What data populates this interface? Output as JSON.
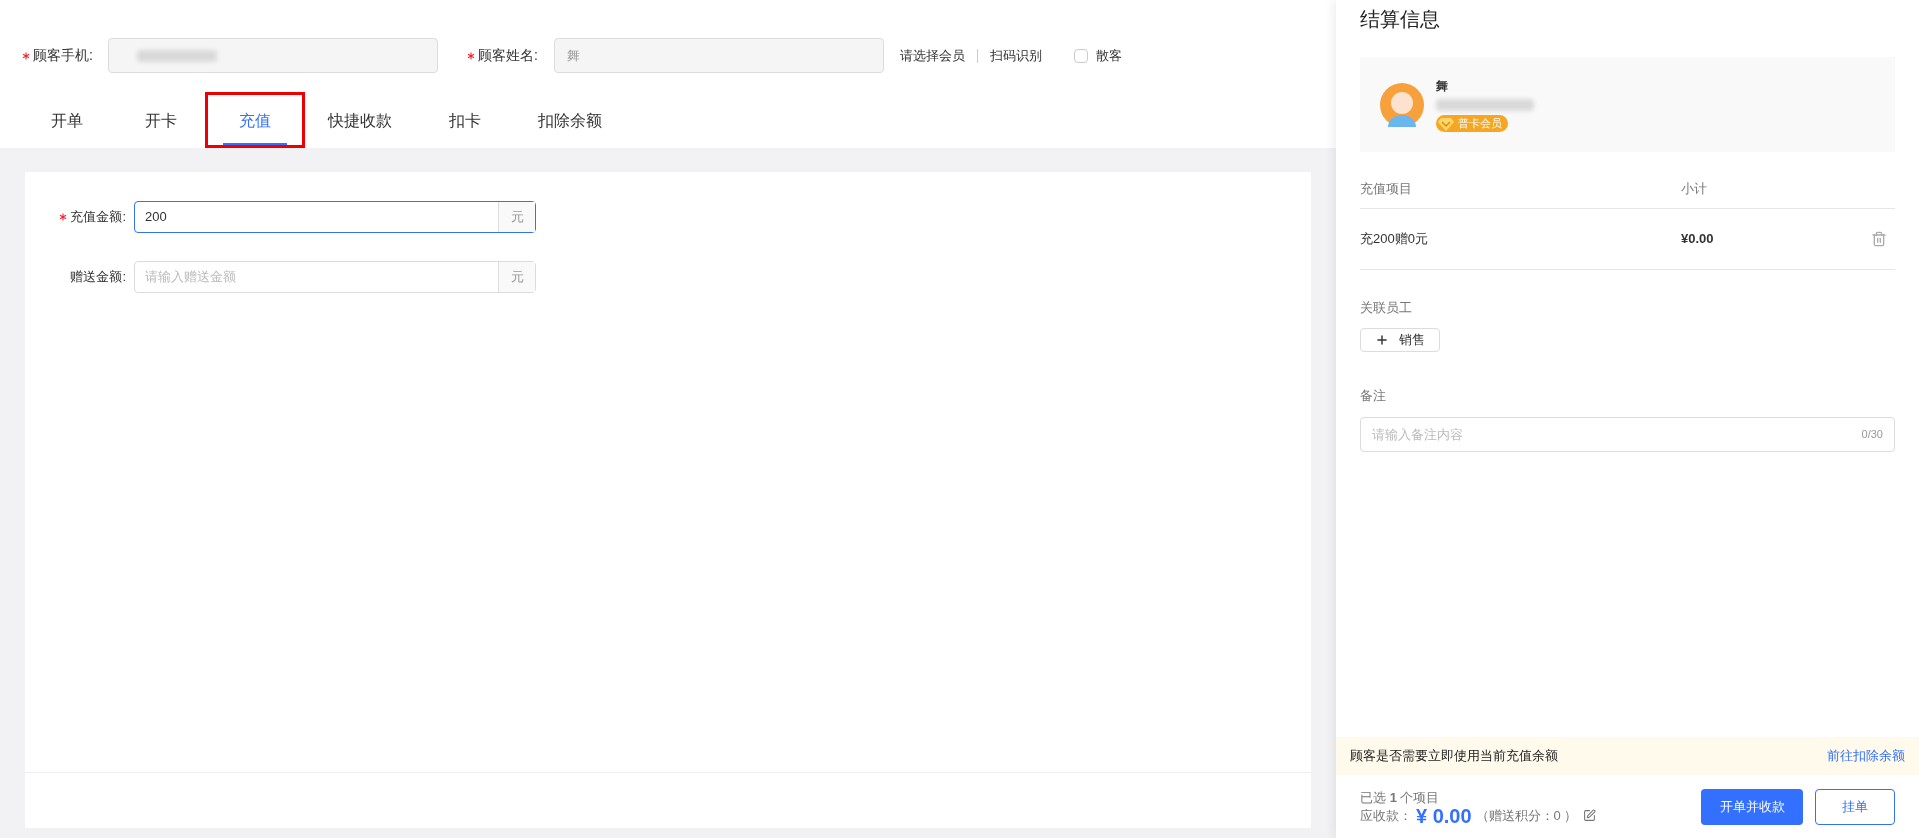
{
  "customer": {
    "phone": {
      "label": "顾客手机:",
      "required": true
    },
    "name": {
      "label": "顾客姓名:",
      "required": true,
      "value": "舞"
    },
    "links": [
      "请选择会员",
      "扫码识别"
    ],
    "walk_in": {
      "label": "散客",
      "checked": false
    }
  },
  "tabs": [
    {
      "label": "开单",
      "selected": false,
      "highlighted": false
    },
    {
      "label": "开卡",
      "selected": false,
      "highlighted": false
    },
    {
      "label": "充值",
      "selected": true,
      "highlighted": true
    },
    {
      "label": "快捷收款",
      "selected": false,
      "highlighted": false
    },
    {
      "label": "扣卡",
      "selected": false,
      "highlighted": false
    },
    {
      "label": "扣除余额",
      "selected": false,
      "highlighted": false
    }
  ],
  "form": {
    "fields": [
      {
        "label": "充值金额:",
        "required": true,
        "value": "200",
        "focused": true,
        "unit": "元"
      },
      {
        "label": "赠送金额:",
        "required": false,
        "placeholder": "请输入赠送金额",
        "focused": false,
        "unit": "元"
      }
    ]
  },
  "settlement": {
    "title": "结算信息",
    "member": {
      "name": "舞",
      "badge": "普卡会员"
    },
    "table": {
      "columns": [
        "充值项目",
        "小计"
      ],
      "rows": [
        {
          "item": "充200赠0元",
          "subtotal": "¥0.00"
        }
      ]
    },
    "staff": {
      "label": "关联员工",
      "button": "销售"
    },
    "remark": {
      "label": "备注",
      "placeholder": "请输入备注内容",
      "counter": "0/30"
    },
    "notice": {
      "text": "顾客是否需要立即使用当前充值余额",
      "link": "前往扣除余额"
    },
    "summary": {
      "selected": "已选 **1** 个项目",
      "amount_label": "应收款：",
      "amount": "¥ 0.00",
      "points": "（赠送积分：0 ）"
    },
    "buttons": [
      {
        "label": "开单并收款",
        "kind": "primary"
      },
      {
        "label": "挂单",
        "kind": "secondary"
      }
    ]
  }
}
